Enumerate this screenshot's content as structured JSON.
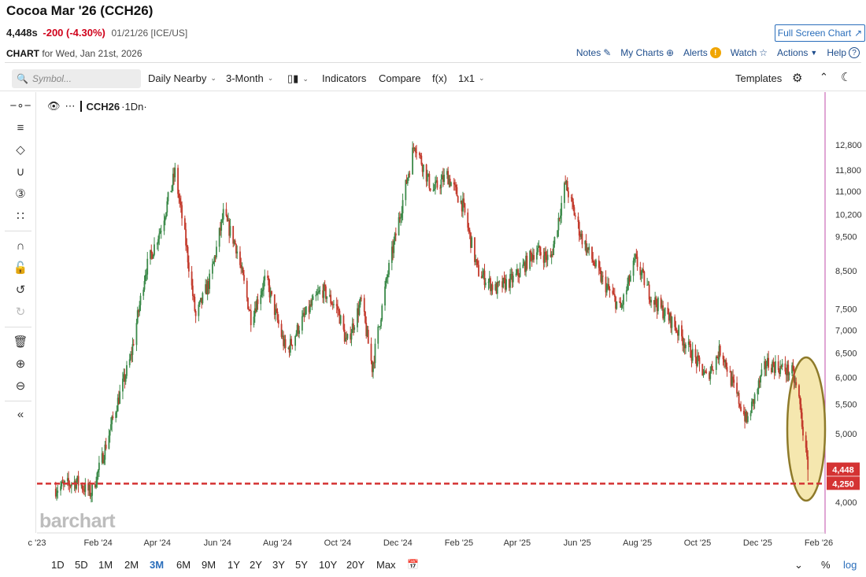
{
  "header": {
    "title": "Cocoa Mar '26 (CCH26)",
    "price": "4,448s",
    "change": "-200 (-4.30%)",
    "meta": "01/21/26 [ICE/US]",
    "fullscreen_label": "Full Screen Chart",
    "chart_label": "CHART",
    "chart_date": "for Wed, Jan 21st, 2026"
  },
  "links": {
    "notes": "Notes",
    "mycharts": "My Charts",
    "alerts": "Alerts",
    "watch": "Watch",
    "actions": "Actions",
    "help": "Help"
  },
  "toolbar": {
    "search_placeholder": "Symbol...",
    "interval": "Daily Nearby",
    "period": "3-Month",
    "indicators": "Indicators",
    "compare": "Compare",
    "fx": "f(x)",
    "layout": "1x1",
    "templates": "Templates"
  },
  "legend": {
    "symbol": "CCH26",
    "interval": "·1Dn·"
  },
  "watermark": "barchart",
  "bottom": {
    "periods": [
      "1D",
      "5D",
      "1M",
      "2M",
      "3M",
      "6M",
      "9M",
      "1Y",
      "2Y",
      "3Y",
      "5Y",
      "10Y",
      "20Y",
      "Max"
    ],
    "active": "3M",
    "percent": "%",
    "log": "log"
  },
  "colors": {
    "up": "#3c8a4a",
    "down": "#c33a2c",
    "accent": "#2a6ebb",
    "neg": "#d0021b",
    "ellipse_fill": "#f3e3a1",
    "ellipse_stroke": "#8e7a2a",
    "ref_line": "#d43333",
    "right_border": "#c04ca8"
  },
  "chart_data": {
    "type": "candlestick",
    "scale": "log",
    "y_ticks": [
      "12,800",
      "11,800",
      "11,000",
      "10,200",
      "9,500",
      "8,500",
      "7,500",
      "7,000",
      "6,500",
      "6,000",
      "5,500",
      "5,000",
      "4,000"
    ],
    "y_tick_values": [
      12800,
      11800,
      11000,
      10200,
      9500,
      8500,
      7500,
      7000,
      6500,
      6000,
      5500,
      5000,
      4000
    ],
    "x_ticks": [
      "c '23",
      "Feb '24",
      "Apr '24",
      "Jun '24",
      "Aug '24",
      "Oct '24",
      "Dec '24",
      "Feb '25",
      "Apr '25",
      "Jun '25",
      "Aug '25",
      "Oct '25",
      "Dec '25",
      "Feb '26"
    ],
    "last_price_label": "4,448",
    "ref_level_label": "4,250",
    "last_price": 4448,
    "ref_level": 4250,
    "path": [
      [
        "2023-12-20",
        4180
      ],
      [
        "2024-01-10",
        4280
      ],
      [
        "2024-01-25",
        4120
      ],
      [
        "2024-02-05",
        4600
      ],
      [
        "2024-02-20",
        5500
      ],
      [
        "2024-03-05",
        6400
      ],
      [
        "2024-03-20",
        8500
      ],
      [
        "2024-04-05",
        9800
      ],
      [
        "2024-04-19",
        11700
      ],
      [
        "2024-04-30",
        9300
      ],
      [
        "2024-05-10",
        7300
      ],
      [
        "2024-05-25",
        8300
      ],
      [
        "2024-06-07",
        10200
      ],
      [
        "2024-06-20",
        9200
      ],
      [
        "2024-07-05",
        7300
      ],
      [
        "2024-07-20",
        8300
      ],
      [
        "2024-08-10",
        6500
      ],
      [
        "2024-08-25",
        7200
      ],
      [
        "2024-09-15",
        8000
      ],
      [
        "2024-10-01",
        7500
      ],
      [
        "2024-10-10",
        6700
      ],
      [
        "2024-10-25",
        7700
      ],
      [
        "2024-11-05",
        6200
      ],
      [
        "2024-11-20",
        8300
      ],
      [
        "2024-12-05",
        10500
      ],
      [
        "2024-12-18",
        12900
      ],
      [
        "2025-01-05",
        11000
      ],
      [
        "2025-01-20",
        11600
      ],
      [
        "2025-02-05",
        10500
      ],
      [
        "2025-02-20",
        8500
      ],
      [
        "2025-03-10",
        8000
      ],
      [
        "2025-03-30",
        8300
      ],
      [
        "2025-04-20",
        9100
      ],
      [
        "2025-05-05",
        8800
      ],
      [
        "2025-05-20",
        11300
      ],
      [
        "2025-06-05",
        9500
      ],
      [
        "2025-06-25",
        8300
      ],
      [
        "2025-07-15",
        7500
      ],
      [
        "2025-07-30",
        8800
      ],
      [
        "2025-08-15",
        7800
      ],
      [
        "2025-09-05",
        7200
      ],
      [
        "2025-09-25",
        6500
      ],
      [
        "2025-10-10",
        6000
      ],
      [
        "2025-10-25",
        6600
      ],
      [
        "2025-11-05",
        5900
      ],
      [
        "2025-11-20",
        5200
      ],
      [
        "2025-12-01",
        5800
      ],
      [
        "2025-12-10",
        6300
      ],
      [
        "2026-01-05",
        6100
      ],
      [
        "2026-01-12",
        5600
      ],
      [
        "2026-01-18",
        4800
      ],
      [
        "2026-01-21",
        4448
      ]
    ]
  }
}
